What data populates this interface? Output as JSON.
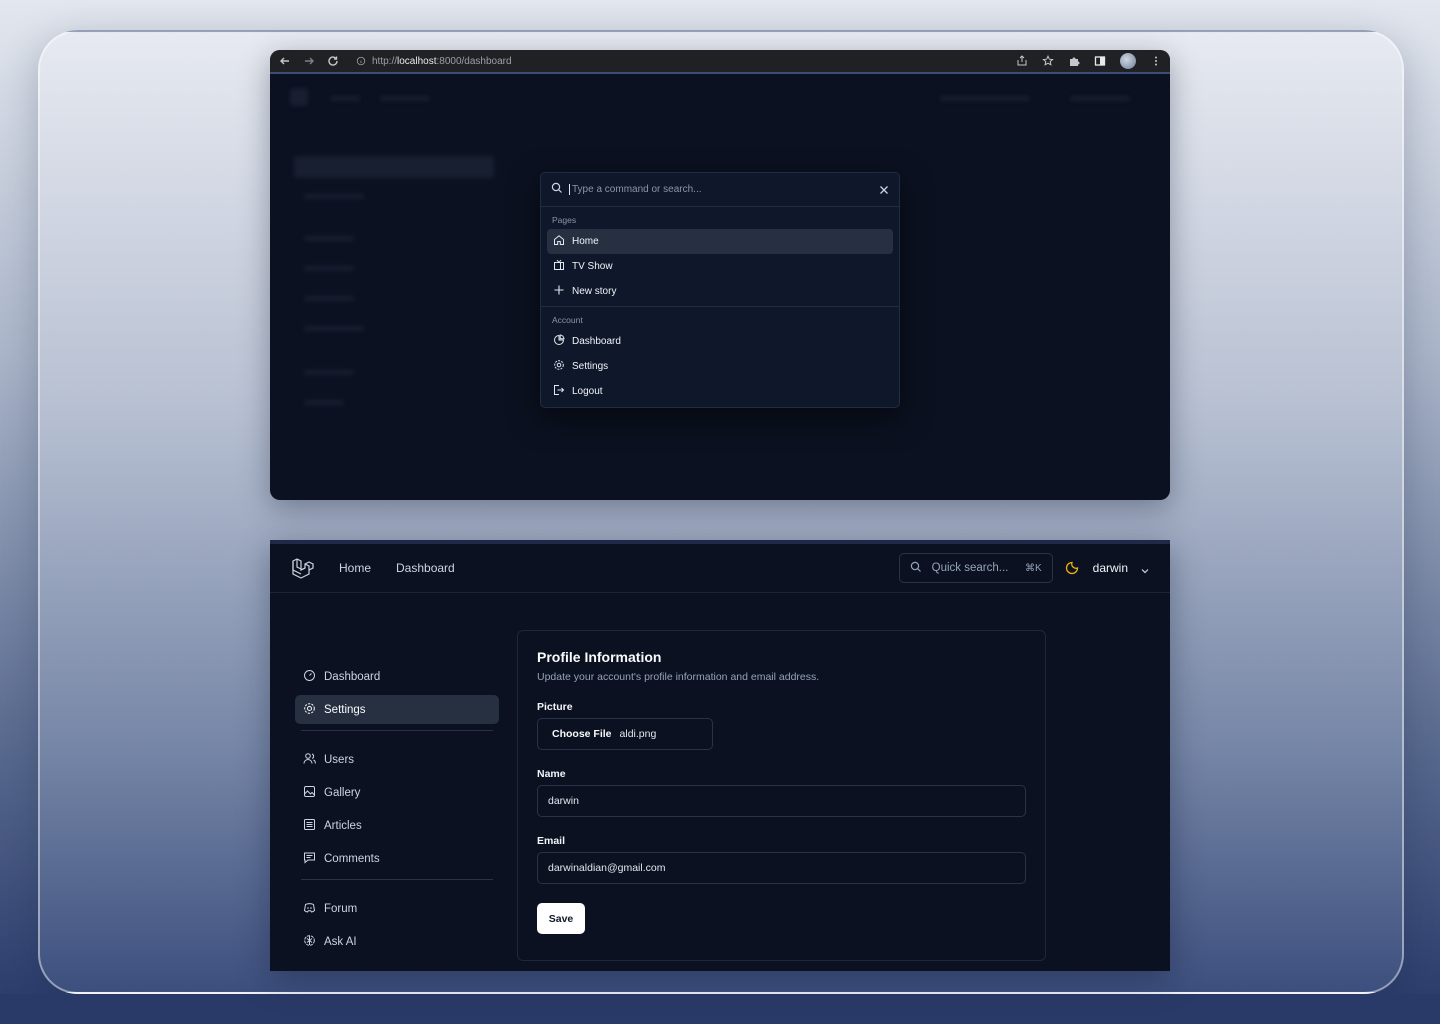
{
  "browser": {
    "url_scheme": "http://",
    "url_host": "localhost",
    "url_path": ":8000/dashboard"
  },
  "command_palette": {
    "placeholder": "Type a command or search...",
    "groups": [
      {
        "label": "Pages",
        "items": [
          {
            "label": "Home",
            "icon": "home-icon",
            "active": true
          },
          {
            "label": "TV Show",
            "icon": "tv-icon"
          },
          {
            "label": "New story",
            "icon": "plus-icon"
          }
        ]
      },
      {
        "label": "Account",
        "items": [
          {
            "label": "Dashboard",
            "icon": "pie-chart-icon"
          },
          {
            "label": "Settings",
            "icon": "gear-icon"
          },
          {
            "label": "Logout",
            "icon": "logout-icon"
          }
        ]
      }
    ]
  },
  "app": {
    "header": {
      "nav": [
        "Home",
        "Dashboard"
      ],
      "search_label": "Quick search...",
      "search_shortcut": "⌘K",
      "user_name": "darwin"
    },
    "sidebar": {
      "items": [
        {
          "label": "Dashboard",
          "icon": "dashboard-icon"
        },
        {
          "label": "Settings",
          "icon": "gear-icon",
          "active": true
        },
        {
          "label": "Users",
          "icon": "users-icon"
        },
        {
          "label": "Gallery",
          "icon": "image-icon"
        },
        {
          "label": "Articles",
          "icon": "article-icon"
        },
        {
          "label": "Comments",
          "icon": "comment-icon"
        },
        {
          "label": "Forum",
          "icon": "discord-icon"
        },
        {
          "label": "Ask AI",
          "icon": "openai-icon"
        }
      ]
    },
    "profile": {
      "title": "Profile Information",
      "subtitle": "Update your account's profile information and email address.",
      "picture_label": "Picture",
      "choose_file": "Choose File",
      "file_name": "aldi.png",
      "name_label": "Name",
      "name_value": "darwin",
      "email_label": "Email",
      "email_value": "darwinaldian@gmail.com",
      "save_label": "Save"
    }
  },
  "colors": {
    "accent_theme": "#eab308",
    "panel_bg": "#0b1120",
    "active_item_bg": "#263041"
  }
}
